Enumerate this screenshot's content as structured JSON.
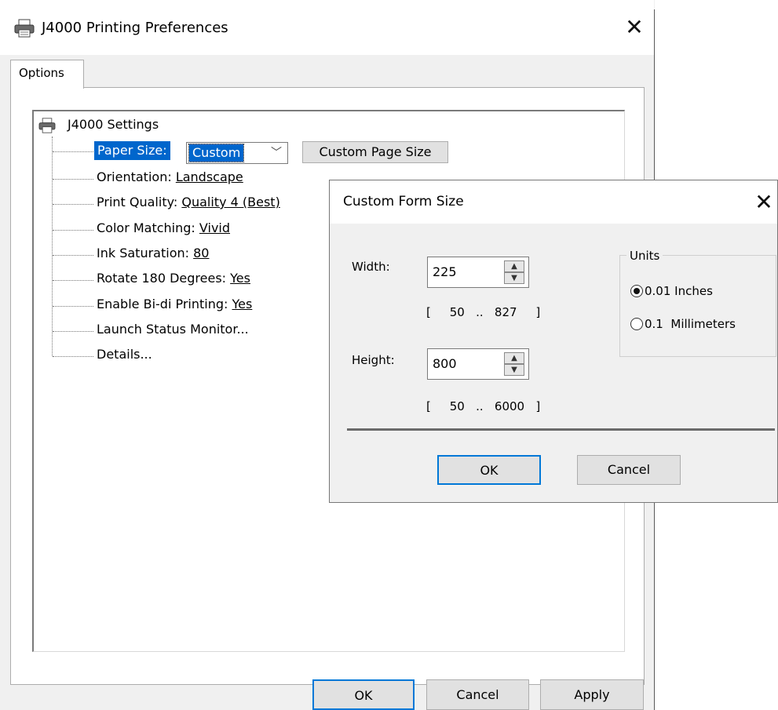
{
  "window": {
    "title": "J4000 Printing Preferences",
    "close_symbol": "✕"
  },
  "tabs": [
    {
      "label": "Options",
      "selected": true
    }
  ],
  "tree": {
    "root": "J4000 Settings",
    "paper_size": {
      "label": "Paper Size:",
      "value": "Custom",
      "button": "Custom Page Size"
    },
    "items": [
      {
        "label": "Orientation: ",
        "value": "Landscape"
      },
      {
        "label": "Print Quality: ",
        "value": "Quality 4 (Best)"
      },
      {
        "label": "Color Matching: ",
        "value": "Vivid"
      },
      {
        "label": "Ink Saturation: ",
        "value": "80"
      },
      {
        "label": "Rotate 180 Degrees: ",
        "value": "Yes"
      },
      {
        "label": "Enable Bi-di Printing: ",
        "value": "Yes"
      },
      {
        "label": "Launch Status Monitor...",
        "value": ""
      },
      {
        "label": "Details...",
        "value": ""
      }
    ]
  },
  "buttons": {
    "ok": "OK",
    "cancel": "Cancel",
    "apply": "Apply"
  },
  "dialog": {
    "title": "Custom Form Size",
    "close_symbol": "✕",
    "width": {
      "label": "Width:",
      "value": "225",
      "range": "[     50   ..   827     ]"
    },
    "height": {
      "label": "Height:",
      "value": "800",
      "range": "[     50   ..   6000   ]"
    },
    "units": {
      "legend": "Units",
      "options": [
        {
          "label": "0.01 Inches",
          "checked": true
        },
        {
          "label": "0.1  Millimeters",
          "checked": false
        }
      ]
    },
    "ok": "OK",
    "cancel": "Cancel"
  },
  "icons": {
    "title": "printer-icon",
    "tree_root": "printer-icon",
    "spin_up": "▲",
    "spin_down": "▼",
    "dropdown": "﹀"
  },
  "colors": {
    "selection": "#0066cc",
    "focus_border": "#0078d7",
    "window_bg": "#f0f0f0"
  }
}
